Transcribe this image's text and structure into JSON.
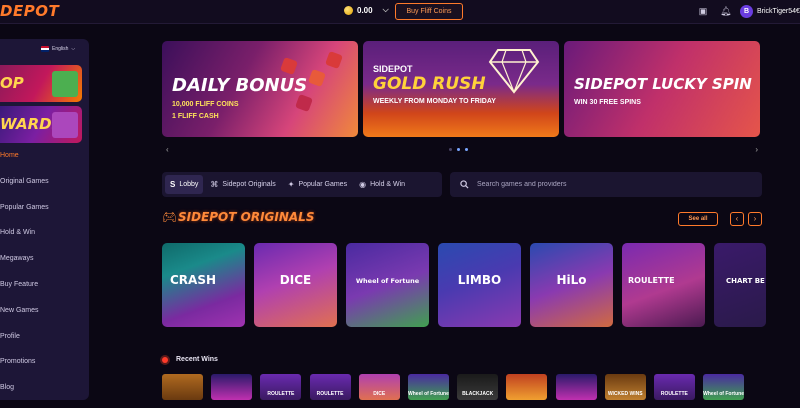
{
  "header": {
    "logo": "DEPOT",
    "balance": "0.00",
    "buy_label": "Buy Fliff Coins",
    "username": "BrickTiger54€",
    "avatar_letter": "B"
  },
  "sidebar": {
    "language": "English",
    "promos": [
      {
        "text": "OP"
      },
      {
        "text": "WARDS"
      }
    ],
    "items": [
      {
        "label": "Home"
      },
      {
        "label": "Original Games"
      },
      {
        "label": "Popular Games"
      },
      {
        "label": "Hold & Win"
      },
      {
        "label": "Megaways"
      },
      {
        "label": "Buy Feature"
      },
      {
        "label": "New Games"
      },
      {
        "label": "Profile"
      },
      {
        "label": "Promotions"
      },
      {
        "label": "Blog"
      }
    ]
  },
  "banners": [
    {
      "title": "DAILY BONUS",
      "line1": "10,000 FLIFF COINS",
      "line2": "1 FLIFF CASH"
    },
    {
      "pre": "SIDEPOT",
      "title": "GOLD RUSH",
      "line1": "WEEKLY FROM MONDAY TO FRIDAY"
    },
    {
      "title": "SIDEPOT LUCKY SPIN",
      "line1": "WIN 30 FREE SPINS"
    }
  ],
  "tabs": [
    {
      "label": "Lobby",
      "icon": "s-logo-icon"
    },
    {
      "label": "Sidepot Originals",
      "icon": "gamepad-icon"
    },
    {
      "label": "Popular Games",
      "icon": "star-icon"
    },
    {
      "label": "Hold & Win",
      "icon": "coin-icon"
    }
  ],
  "search": {
    "placeholder": "Search games and providers"
  },
  "originals": {
    "title": "SIDEPOT ORIGINALS",
    "see_all": "See all",
    "games": [
      {
        "name": "CRASH"
      },
      {
        "name": "DICE"
      },
      {
        "name": "Wheel of Fortune"
      },
      {
        "name": "LIMBO"
      },
      {
        "name": "HiLo"
      },
      {
        "name": "ROULETTE"
      },
      {
        "name": "CHART BE"
      }
    ]
  },
  "recent_wins": {
    "title": "Recent Wins",
    "items": [
      {
        "label": ""
      },
      {
        "label": ""
      },
      {
        "label": "ROULETTE"
      },
      {
        "label": "ROULETTE"
      },
      {
        "label": "DICE"
      },
      {
        "label": "Wheel of Fortune"
      },
      {
        "label": "BLACKJACK"
      },
      {
        "label": ""
      },
      {
        "label": ""
      },
      {
        "label": "WICKED WINS"
      },
      {
        "label": "ROULETTE"
      },
      {
        "label": "Wheel of Fortune"
      }
    ]
  },
  "colors": {
    "accent": "#ff7a2b",
    "background": "#0b0714",
    "sidebar": "#1d1637"
  }
}
